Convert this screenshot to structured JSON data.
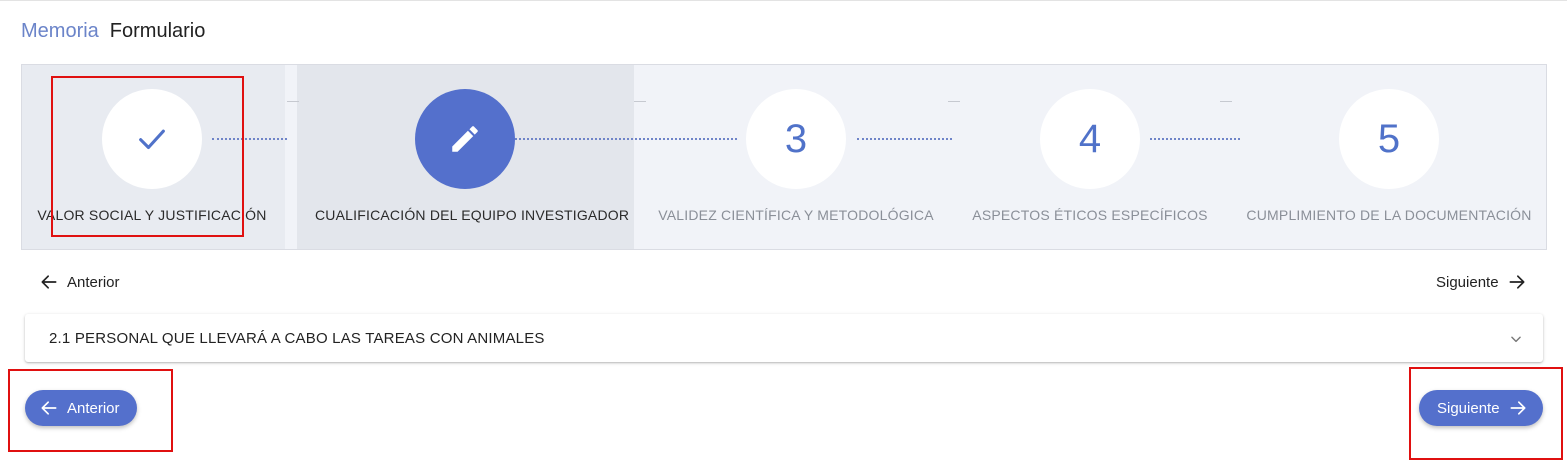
{
  "breadcrumb": {
    "parent": "Memoria",
    "current": "Formulario"
  },
  "stepper": {
    "steps": [
      {
        "number": "",
        "label": "VALOR SOCIAL Y JUSTIFICACIÓN",
        "state": "completed",
        "icon": "check-icon"
      },
      {
        "number": "",
        "label": "CUALIFICACIÓN DEL EQUIPO INVESTIGADOR",
        "state": "active",
        "icon": "pencil-icon"
      },
      {
        "number": "3",
        "label": "VALIDEZ CIENTÍFICA Y METODOLÓGICA",
        "state": "pending"
      },
      {
        "number": "4",
        "label": "ASPECTOS ÉTICOS ESPECÍFICOS",
        "state": "pending"
      },
      {
        "number": "5",
        "label": "CUMPLIMIENTO DE LA DOCUMENTACIÓN",
        "state": "pending"
      }
    ]
  },
  "nav": {
    "prev_label": "Anterior",
    "next_label": "Siguiente"
  },
  "accordion": {
    "title": "2.1 PERSONAL QUE LLEVARÁ A CABO LAS TAREAS CON ANIMALES",
    "icon": "chevron-down-icon"
  },
  "buttons": {
    "prev_label": "Anterior",
    "next_label": "Siguiente"
  },
  "colors": {
    "accent": "#5470cc",
    "highlight": "#e01010"
  }
}
